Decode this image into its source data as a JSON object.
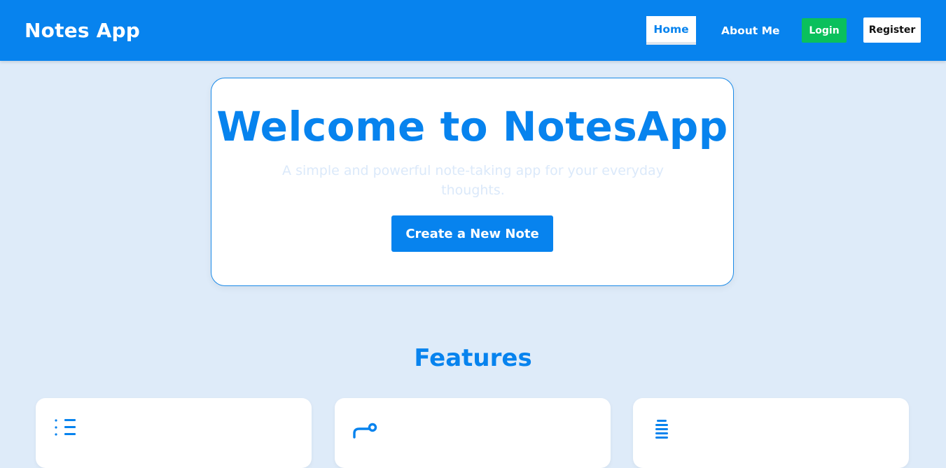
{
  "navbar": {
    "brand": "Notes App",
    "home_label": "Home",
    "about_label": "About Me",
    "login_label": "Login",
    "register_label": "Register"
  },
  "hero": {
    "title": "Welcome to NotesApp",
    "subtitle": "A simple and powerful note-taking app for your everyday thoughts.",
    "cta_label": "Create a New Note"
  },
  "features": {
    "title": "Features",
    "cards": [
      {
        "icon": "list-icon"
      },
      {
        "icon": "link-icon"
      },
      {
        "icon": "stack-icon"
      }
    ]
  },
  "colors": {
    "primary": "#0783ee",
    "success": "#0ac05c",
    "background": "#deebf9",
    "white": "#ffffff"
  }
}
